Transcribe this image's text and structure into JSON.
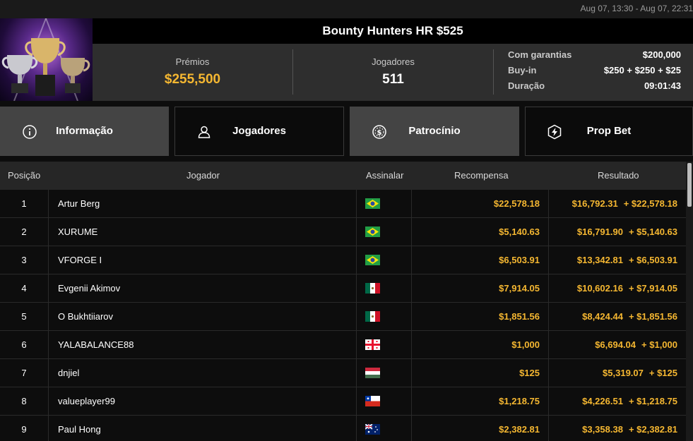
{
  "topbar": {
    "date_range": "Aug 07, 13:30 - Aug 07, 22:31"
  },
  "tournament": {
    "title": "Bounty Hunters HR $525",
    "prizes_label": "Prémios",
    "prizes_value": "$255,500",
    "players_label": "Jogadores",
    "players_value": "511",
    "details": [
      {
        "label": "Com garantias",
        "value": "$200,000"
      },
      {
        "label": "Buy-in",
        "value": "$250 + $250 + $25"
      },
      {
        "label": "Duração",
        "value": "09:01:43"
      }
    ]
  },
  "tabs": [
    {
      "label": "Informação",
      "icon": "info-icon",
      "active": true
    },
    {
      "label": "Jogadores",
      "icon": "user-icon",
      "active": false
    },
    {
      "label": "Patrocínio",
      "icon": "dollar-coin-icon",
      "active": true
    },
    {
      "label": "Prop Bet",
      "icon": "shield-bolt-icon",
      "active": false
    }
  ],
  "table": {
    "headers": {
      "position": "Posição",
      "player": "Jogador",
      "flag": "Assinalar",
      "reward": "Recompensa",
      "result": "Resultado"
    },
    "rows": [
      {
        "position": "1",
        "player": "Artur Berg",
        "flag": "BR",
        "reward": "$22,578.18",
        "result": "$16,792.31",
        "result_plus": "+ $22,578.18"
      },
      {
        "position": "2",
        "player": "XURUME",
        "flag": "BR",
        "reward": "$5,140.63",
        "result": "$16,791.90",
        "result_plus": "+ $5,140.63"
      },
      {
        "position": "3",
        "player": "VFORGE I",
        "flag": "BR",
        "reward": "$6,503.91",
        "result": "$13,342.81",
        "result_plus": "+ $6,503.91"
      },
      {
        "position": "4",
        "player": "Evgenii Akimov",
        "flag": "MX",
        "reward": "$7,914.05",
        "result": "$10,602.16",
        "result_plus": "+ $7,914.05"
      },
      {
        "position": "5",
        "player": "O Bukhtiiarov",
        "flag": "MX",
        "reward": "$1,851.56",
        "result": "$8,424.44",
        "result_plus": "+ $1,851.56"
      },
      {
        "position": "6",
        "player": "YALABALANCE88",
        "flag": "GE",
        "reward": "$1,000",
        "result": "$6,694.04",
        "result_plus": "+ $1,000"
      },
      {
        "position": "7",
        "player": "dnjiel",
        "flag": "HU",
        "reward": "$125",
        "result": "$5,319.07",
        "result_plus": "+ $125"
      },
      {
        "position": "8",
        "player": "valueplayer99",
        "flag": "CL",
        "reward": "$1,218.75",
        "result": "$4,226.51",
        "result_plus": "+ $1,218.75"
      },
      {
        "position": "9",
        "player": "Paul Hong",
        "flag": "AU",
        "reward": "$2,382.81",
        "result": "$3,358.38",
        "result_plus": "+ $2,382.81"
      }
    ]
  },
  "colors": {
    "gold": "#f5b731",
    "tab_active": "#444444",
    "header_bg": "#2e2e2e"
  }
}
